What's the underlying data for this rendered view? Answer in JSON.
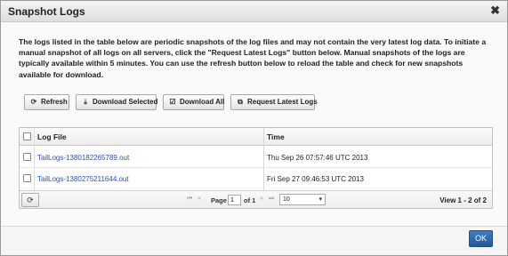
{
  "dialog": {
    "title": "Snapshot Logs",
    "close_glyph": "✖"
  },
  "description": "The logs listed in the table below are periodic snapshots of the log files and may not contain the very latest log data. To initiate a manual snapshot of all logs on all servers, click the \"Request Latest Logs\" button below. Manual snapshots of the logs are typically available within 5 minutes. You can use the refresh button below to reload the table and check for new snapshots available for download.",
  "toolbar": {
    "refresh": {
      "label": "Refresh",
      "icon": "refresh-icon",
      "glyph": "⟳"
    },
    "download_selected": {
      "label": "Download Selected",
      "icon": "download-icon",
      "glyph": "⤓"
    },
    "download_all": {
      "label": "Download All",
      "icon": "checkbox-icon",
      "glyph": "☑"
    },
    "request_latest": {
      "label": "Request Latest Logs",
      "icon": "copy-icon",
      "glyph": "⧉"
    }
  },
  "table": {
    "columns": [
      "Log File",
      "Time"
    ],
    "rows": [
      {
        "file": "TailLogs-1380182265789.out",
        "time": "Thu Sep 26 07:57:46 UTC 2013"
      },
      {
        "file": "TailLogs-1380275211644.out",
        "time": "Fri Sep 27 09:46:53 UTC 2013"
      }
    ]
  },
  "pager": {
    "refresh_glyph": "⟳",
    "first_glyph": "⏮",
    "prev_glyph": "«",
    "next_glyph": "»",
    "last_glyph": "⏭",
    "page_label": "Page",
    "page_value": "1",
    "of_label": "of 1",
    "rows_per_page": "10",
    "select_arrow": "▾",
    "view_info": "View 1 - 2 of 2"
  },
  "footer": {
    "ok_label": "OK"
  },
  "colors": {
    "link": "#2a4fb5",
    "ok_button": "#1e5aa3"
  }
}
